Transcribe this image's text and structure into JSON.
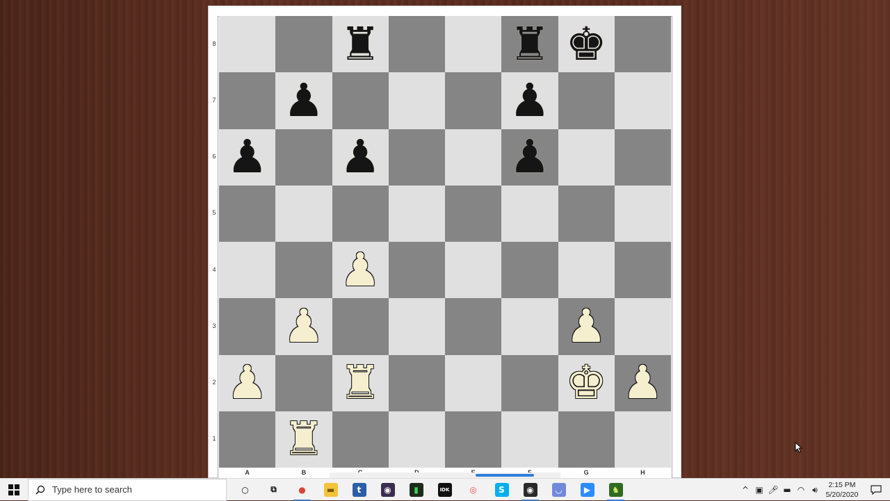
{
  "board": {
    "ranks": [
      "8",
      "7",
      "6",
      "5",
      "4",
      "3",
      "2",
      "1"
    ],
    "files": [
      "A",
      "B",
      "C",
      "D",
      "E",
      "F",
      "G",
      "H"
    ],
    "pieces": [
      {
        "square": "c8",
        "color": "black",
        "type": "rook",
        "symbol": "♜"
      },
      {
        "square": "f8",
        "color": "black",
        "type": "rook",
        "symbol": "♜"
      },
      {
        "square": "g8",
        "color": "black",
        "type": "king",
        "symbol": "♚"
      },
      {
        "square": "b7",
        "color": "black",
        "type": "pawn",
        "symbol": "♟"
      },
      {
        "square": "f7",
        "color": "black",
        "type": "pawn",
        "symbol": "♟"
      },
      {
        "square": "a6",
        "color": "black",
        "type": "pawn",
        "symbol": "♟"
      },
      {
        "square": "c6",
        "color": "black",
        "type": "pawn",
        "symbol": "♟"
      },
      {
        "square": "f6",
        "color": "black",
        "type": "pawn",
        "symbol": "♟"
      },
      {
        "square": "c4",
        "color": "white",
        "type": "pawn",
        "symbol": "♟"
      },
      {
        "square": "b3",
        "color": "white",
        "type": "pawn",
        "symbol": "♟"
      },
      {
        "square": "g3",
        "color": "white",
        "type": "pawn",
        "symbol": "♟"
      },
      {
        "square": "a2",
        "color": "white",
        "type": "pawn",
        "symbol": "♟"
      },
      {
        "square": "c2",
        "color": "white",
        "type": "rook",
        "symbol": "♜"
      },
      {
        "square": "g2",
        "color": "white",
        "type": "king",
        "symbol": "♚"
      },
      {
        "square": "h2",
        "color": "white",
        "type": "pawn",
        "symbol": "♟"
      },
      {
        "square": "b1",
        "color": "white",
        "type": "rook",
        "symbol": "♜"
      }
    ],
    "colors": {
      "light": "#e0e0e0",
      "dark": "#858585"
    }
  },
  "taskbar": {
    "search_placeholder": "Type here to search",
    "apps": [
      {
        "name": "cortana",
        "glyph": "○",
        "bg": "transparent",
        "fg": "#111"
      },
      {
        "name": "task-view",
        "glyph": "⧉",
        "bg": "transparent",
        "fg": "#111"
      },
      {
        "name": "chrome",
        "glyph": "●",
        "bg": "transparent",
        "fg": "#db4437",
        "active": true
      },
      {
        "name": "file-explorer",
        "glyph": "▬",
        "bg": "#f3c33b",
        "fg": "#7a5a00"
      },
      {
        "name": "typora",
        "glyph": "t",
        "bg": "#2b5fa8",
        "fg": "#fff"
      },
      {
        "name": "obs",
        "glyph": "◉",
        "bg": "#3a2d4f",
        "fg": "#fff"
      },
      {
        "name": "audio-meter",
        "glyph": "▮",
        "bg": "#1d2b1d",
        "fg": "#3fd35c"
      },
      {
        "name": "idk-app",
        "glyph": "IDK",
        "bg": "#111",
        "fg": "#fff"
      },
      {
        "name": "ring-app",
        "glyph": "◎",
        "bg": "transparent",
        "fg": "#ef4e4e"
      },
      {
        "name": "skype",
        "glyph": "S",
        "bg": "#00aff0",
        "fg": "#fff"
      },
      {
        "name": "obs-studio",
        "glyph": "◉",
        "bg": "#2a2a2a",
        "fg": "#fff",
        "active": true
      },
      {
        "name": "discord",
        "glyph": "◡",
        "bg": "#7289da",
        "fg": "#fff"
      },
      {
        "name": "zoom",
        "glyph": "▶",
        "bg": "#2d8cff",
        "fg": "#fff"
      },
      {
        "name": "chess-app",
        "glyph": "♞",
        "bg": "#2f6a22",
        "fg": "#cfe86a",
        "active": true
      }
    ],
    "tray": {
      "show_hidden": "^",
      "time": "2:15 PM",
      "date": "5/20/2020"
    }
  }
}
